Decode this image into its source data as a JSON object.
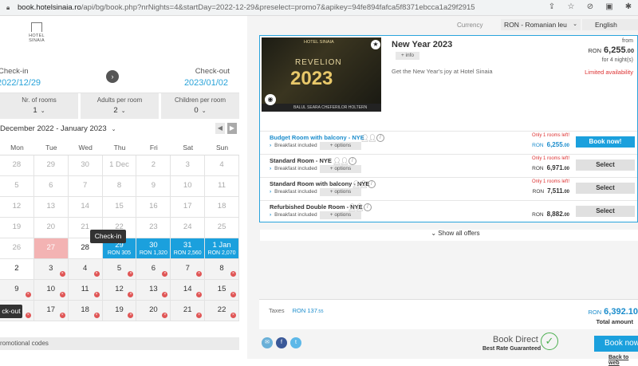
{
  "browser": {
    "host": "book.hotelsinaia.ro",
    "path": "/api/bg/book.php?nrNights=4&startDay=2022-12-29&preselect=promo7&apikey=94fe894fafca5f8371ebcca1a29f2915"
  },
  "logo": {
    "text": "HOTEL SINAIA"
  },
  "dates": {
    "checkin_label": "Check-in",
    "checkout_label": "Check-out",
    "checkin_value": "2022/12/29",
    "checkout_value": "2023/01/02"
  },
  "rooms": {
    "nr_label": "Nr. of rooms",
    "nr_value": "1",
    "adults_label": "Adults per room",
    "adults_value": "2",
    "children_label": "Children per room",
    "children_value": "0"
  },
  "calendar": {
    "month_label": "December 2022 - January 2023",
    "weekdays": [
      "Mon",
      "Tue",
      "Wed",
      "Thu",
      "Fri",
      "Sat",
      "Sun"
    ],
    "cells": [
      {
        "d": "28",
        "s": "past"
      },
      {
        "d": "29",
        "s": "past"
      },
      {
        "d": "30",
        "s": "past"
      },
      {
        "d": "1 Dec",
        "s": "past"
      },
      {
        "d": "2",
        "s": "past"
      },
      {
        "d": "3",
        "s": "past"
      },
      {
        "d": "4",
        "s": "past"
      },
      {
        "d": "5",
        "s": "past"
      },
      {
        "d": "6",
        "s": "past"
      },
      {
        "d": "7",
        "s": "past"
      },
      {
        "d": "8",
        "s": "past"
      },
      {
        "d": "9",
        "s": "past"
      },
      {
        "d": "10",
        "s": "past"
      },
      {
        "d": "11",
        "s": "past"
      },
      {
        "d": "12",
        "s": "past"
      },
      {
        "d": "13",
        "s": "past"
      },
      {
        "d": "14",
        "s": "past"
      },
      {
        "d": "15",
        "s": "past"
      },
      {
        "d": "16",
        "s": "past"
      },
      {
        "d": "17",
        "s": "past"
      },
      {
        "d": "18",
        "s": "past"
      },
      {
        "d": "19",
        "s": "past"
      },
      {
        "d": "20",
        "s": "past"
      },
      {
        "d": "21",
        "s": "past"
      },
      {
        "d": "22",
        "s": "past"
      },
      {
        "d": "23",
        "s": "past"
      },
      {
        "d": "24",
        "s": "past"
      },
      {
        "d": "25",
        "s": "past"
      },
      {
        "d": "26",
        "s": "past"
      },
      {
        "d": "27",
        "s": "red"
      },
      {
        "d": "28",
        "s": "white"
      },
      {
        "d": "29",
        "s": "sel",
        "p": "RON 305"
      },
      {
        "d": "30",
        "s": "sel",
        "p": "RON 1,320"
      },
      {
        "d": "31",
        "s": "sel",
        "p": "RON 2,560"
      },
      {
        "d": "1 Jan",
        "s": "sel",
        "p": "RON 2,070"
      },
      {
        "d": "2",
        "s": "white"
      },
      {
        "d": "3",
        "s": "cur",
        "x": true
      },
      {
        "d": "4",
        "s": "cur",
        "x": true
      },
      {
        "d": "5",
        "s": "cur",
        "x": true
      },
      {
        "d": "6",
        "s": "cur",
        "x": true
      },
      {
        "d": "7",
        "s": "cur",
        "x": true
      },
      {
        "d": "8",
        "s": "cur",
        "x": true
      },
      {
        "d": "9",
        "s": "cur",
        "x": true
      },
      {
        "d": "10",
        "s": "cur",
        "x": true
      },
      {
        "d": "11",
        "s": "cur",
        "x": true
      },
      {
        "d": "12",
        "s": "cur",
        "x": true
      },
      {
        "d": "13",
        "s": "cur",
        "x": true
      },
      {
        "d": "14",
        "s": "cur",
        "x": true
      },
      {
        "d": "15",
        "s": "cur",
        "x": true
      },
      {
        "d": "16",
        "s": "cur",
        "x": true
      },
      {
        "d": "17",
        "s": "cur",
        "x": true
      },
      {
        "d": "18",
        "s": "cur",
        "x": true
      },
      {
        "d": "19",
        "s": "cur",
        "x": true
      },
      {
        "d": "20",
        "s": "cur",
        "x": true
      },
      {
        "d": "21",
        "s": "cur",
        "x": true
      },
      {
        "d": "22",
        "s": "cur",
        "x": true
      }
    ],
    "tooltip_checkin": "Check-in",
    "tooltip_checkout": "ck-out"
  },
  "promo": {
    "label": "romotional codes"
  },
  "topbar": {
    "currency_label": "Currency",
    "currency_value": "RON - Romanian leu",
    "language_value": "English"
  },
  "offer": {
    "image_brand": "HOTEL SINAIA",
    "image_line1": "REVELION",
    "image_line2": "2023",
    "image_strip": "BALUL  SEARA CHEFERILOR  HOLTERN",
    "title": "New Year 2023",
    "info_label": "+ info",
    "description": "Get the New Year's joy at Hotel Sinaia",
    "from_label": "from",
    "currency": "RON",
    "from_price_int": "6,255",
    "from_price_dec": ".00",
    "nights_label": "for 4 night(s)",
    "limited": "Limited availability"
  },
  "rooms_list": [
    {
      "name": "Budget Room with balcony - NYE",
      "breakfast": "Breakfast included",
      "options": "+ options",
      "left": "Only 1 rooms left!",
      "currency": "RON",
      "price_int": "6,255",
      "price_dec": ".00",
      "button": "Book now!"
    },
    {
      "name": "Standard Room - NYE",
      "breakfast": "Breakfast included",
      "options": "+ options",
      "left": "Only 1 rooms left!",
      "currency": "RON",
      "price_int": "6,971",
      "price_dec": ".00",
      "button": "Select"
    },
    {
      "name": "Standard Room with balcony - NYE",
      "breakfast": "Breakfast included",
      "options": "+ options",
      "left": "Only 1 rooms left!",
      "currency": "RON",
      "price_int": "7,511",
      "price_dec": ".00",
      "button": "Select"
    },
    {
      "name": "Refurbished Double Room - NYE",
      "breakfast": "Breakfast included",
      "options": "+ options",
      "left": "",
      "currency": "RON",
      "price_int": "8,882",
      "price_dec": ".00",
      "button": "Select"
    }
  ],
  "show_all": "Show all offers",
  "totals": {
    "taxes_label": "Taxes",
    "taxes_currency": "RON",
    "taxes_int": "137",
    "taxes_dec": ".55",
    "total_currency": "RON",
    "total_value": "6,392.10",
    "total_label": "Total amount"
  },
  "bottom": {
    "book_direct": "Book Direct",
    "best_rate": "Best Rate Guaranteed",
    "book_now": "Book now",
    "back": "Back to web"
  }
}
